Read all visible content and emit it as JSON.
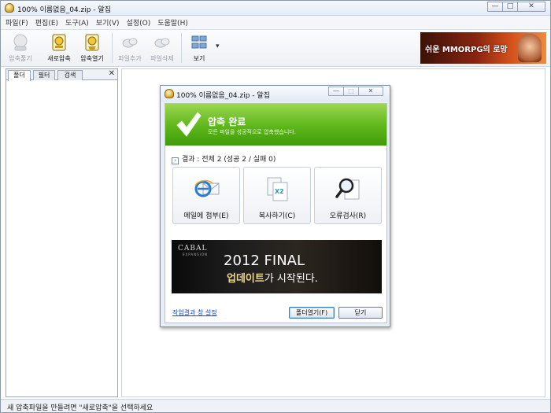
{
  "window": {
    "title": "100% 이름없음_04.zip - 알집",
    "controls": {
      "minimize": "—",
      "maximize": "□",
      "close": "✕"
    }
  },
  "menubar": [
    "파일(F)",
    "편집(E)",
    "도구(A)",
    "보기(V)",
    "설정(O)",
    "도움말(H)"
  ],
  "toolbar": {
    "buttons": [
      {
        "label": "압축풀기",
        "icon": "extract-icon",
        "enabled": false
      },
      {
        "label": "새로압축",
        "icon": "new-archive-icon",
        "enabled": true
      },
      {
        "label": "압축열기",
        "icon": "open-archive-icon",
        "enabled": true
      },
      {
        "label": "파일추가",
        "icon": "add-file-icon",
        "enabled": false
      },
      {
        "label": "파일삭제",
        "icon": "delete-file-icon",
        "enabled": false
      },
      {
        "label": "보기",
        "icon": "view-icon",
        "enabled": true
      }
    ],
    "dropdown": "▾",
    "banner": "쉬운 MMORPG의 로망"
  },
  "leftpanel": {
    "tabs": [
      "폴더",
      "필터",
      "검색"
    ],
    "active_tab": 0,
    "close": "✕"
  },
  "statusbar": {
    "text": "새 압축파일을 만들려면 \"새로압축\"을 선택하세요"
  },
  "dialog": {
    "title": "100% 이름없음_04.zip - 알집",
    "controls": {
      "minimize": "—",
      "maximize": "□",
      "close": "✕"
    },
    "header": {
      "title": "압축 완료",
      "subtitle": "모든 파일을 성공적으로 압축했습니다."
    },
    "result": "결과 : 전체 2 (성공 2 / 실패 0)",
    "result_arrow": "›",
    "actions": [
      {
        "label": "메일에 첨부(E)",
        "icon": "email-attach-icon"
      },
      {
        "label": "복사하기(C)",
        "icon": "copy-icon",
        "badge": "X2"
      },
      {
        "label": "오류검사(R)",
        "icon": "error-check-icon"
      }
    ],
    "ad": {
      "brand": "CABAL",
      "brand_sub": "EXPANSION",
      "line1": "2012 FINAL",
      "line2_strong": "업데이트",
      "line2_rest": "가 시작된다."
    },
    "link": "작업결과 창 설정",
    "buttons": {
      "open_folder": "폴더열기(F)",
      "close": "닫기"
    }
  },
  "colors": {
    "accent_green": "#5db619",
    "link_blue": "#1a4fc8"
  }
}
